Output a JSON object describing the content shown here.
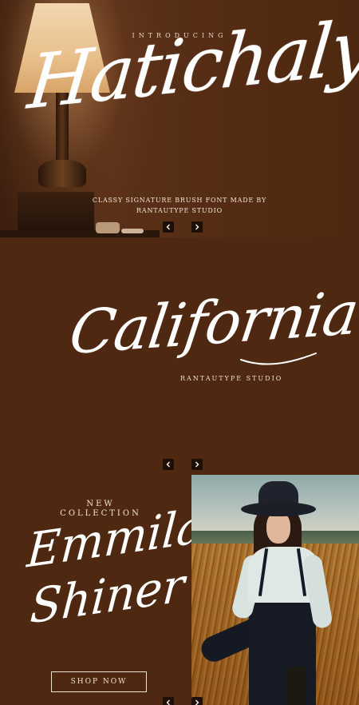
{
  "slide1": {
    "introducing": "INTRODUCING",
    "title": "Hatichaly",
    "tagline_line1": "CLASSY SIGNATURE BRUSH FONT MADE BY",
    "tagline_line2": "RANTAUTYPE STUDIO"
  },
  "slide2": {
    "title": "California",
    "studio": "RANTAUTYPE STUDIO"
  },
  "slide3": {
    "new_line1": "NEW",
    "new_line2": "COLLECTION",
    "script_line1": "Emmila",
    "script_line2": "Shiner",
    "shop_button": "SHOP NOW"
  },
  "icons": {
    "prev": "chevron-left-icon",
    "next": "chevron-right-icon"
  },
  "colors": {
    "background": "#4e2810",
    "nav_button": "#1e0e06",
    "text": "#ffffff",
    "accent_text": "#efe2d0"
  }
}
